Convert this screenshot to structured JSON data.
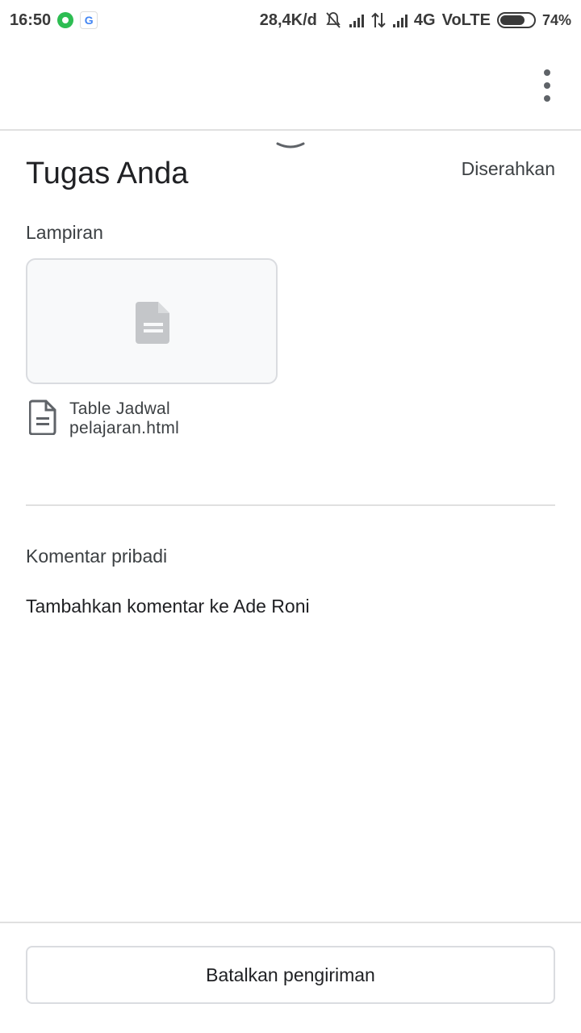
{
  "status_bar": {
    "time": "16:50",
    "speed": "28,4K/d",
    "network": "4G",
    "volte": "VoLTE",
    "battery": "74%",
    "battery_level": 0.74
  },
  "header": {
    "more_icon": "more-vert-icon"
  },
  "assignment": {
    "title": "Tugas Anda",
    "status": "Diserahkan",
    "attachments_label": "Lampiran",
    "attachments": [
      {
        "name": "Table Jadwal pelajaran.html",
        "icon": "document-icon"
      }
    ],
    "private_comments_label": "Komentar pribadi",
    "add_comment": "Tambahkan komentar ke Ade Roni"
  },
  "actions": {
    "unsubmit_label": "Batalkan pengiriman"
  },
  "colors": {
    "text_primary": "#202124",
    "text_secondary": "#3c4043",
    "divider": "#e0e0e0",
    "card_bg": "#f8f9fa"
  }
}
